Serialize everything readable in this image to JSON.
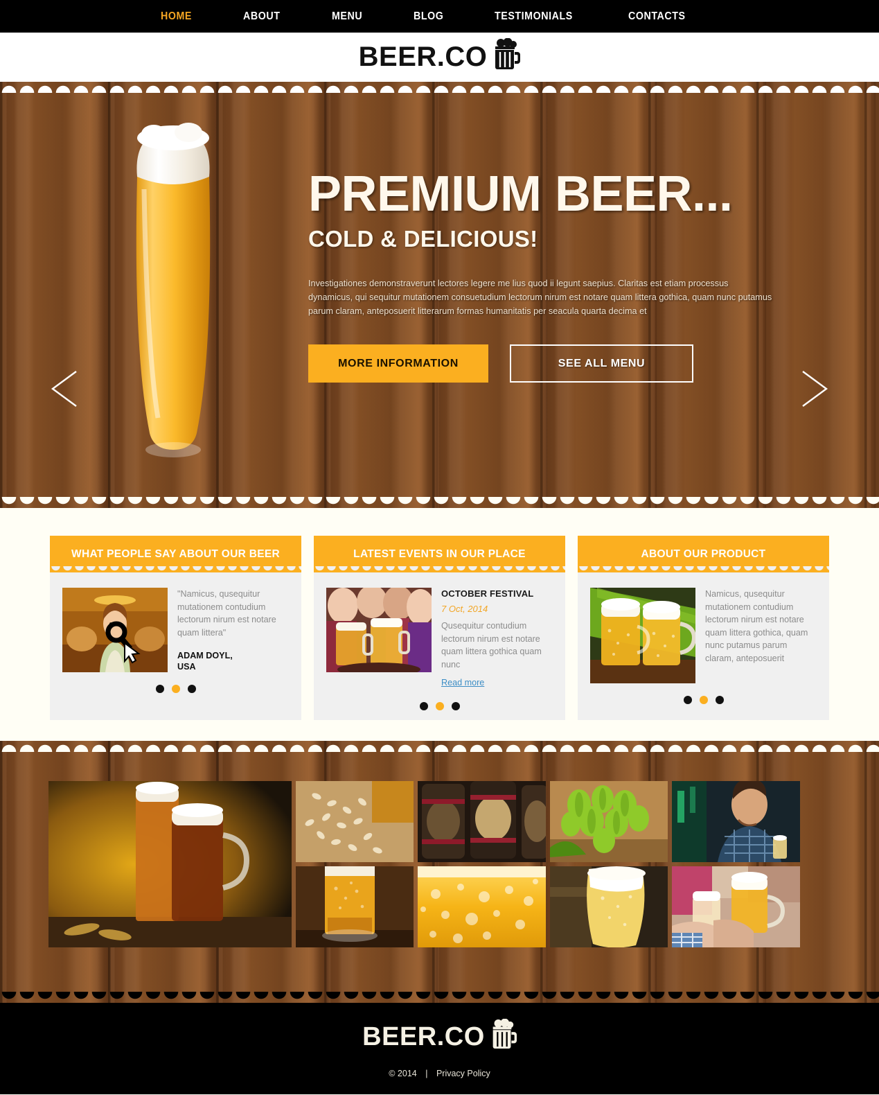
{
  "colors": {
    "accent": "#FBAF20",
    "nav_active": "#F5A623",
    "cream_bg": "#FFFEF5",
    "card_bg": "#F0F0F0",
    "link_blue": "#3C8DC5",
    "wood_dark": "#6E3F1D",
    "black": "#000000"
  },
  "nav": {
    "items": [
      {
        "label": "HOME",
        "active": true
      },
      {
        "label": "ABOUT",
        "active": false
      },
      {
        "label": "MENU",
        "active": false
      },
      {
        "label": "BLOG",
        "active": false
      },
      {
        "label": "TESTIMONIALS",
        "active": false
      },
      {
        "label": "CONTACTS",
        "active": false
      }
    ]
  },
  "logo": {
    "text": "BEER.CO",
    "icon": "beer-mug-icon"
  },
  "hero": {
    "title": "PREMIUM BEER...",
    "subtitle": "COLD & DELICIOUS!",
    "paragraph": "Investigationes demonstraverunt lectores legere me lius quod ii legunt saepius. Claritas est etiam processus dynamicus, qui sequitur mutationem consuetudium lectorum nirum est notare quam littera gothica, quam nunc putamus parum claram, anteposuerit litterarum formas humanitatis per seacula quarta decima et",
    "primary_button": "MORE INFORMATION",
    "secondary_button": "SEE ALL MENU",
    "prev_arrow": "chevron-left-icon",
    "next_arrow": "chevron-right-icon",
    "image_alt": "tall-beer-glass"
  },
  "cards": [
    {
      "id": "testimonials",
      "title": "WHAT PEOPLE SAY ABOUT  OUR BEER",
      "image_alt": "waitress-serving-beer",
      "quote": "\"Namicus, qusequitur mutationem contudium lectorum nirum est notare quam littera\"",
      "author": "ADAM DOYL,\nUSA",
      "author_line1": "ADAM DOYL,",
      "author_line2": "USA",
      "dots": [
        "off",
        "on",
        "off"
      ]
    },
    {
      "id": "events",
      "title": "LATEST EVENTS IN OUR PLACE",
      "image_alt": "people-toasting-beer-mugs",
      "event_title": "OCTOBER FESTIVAL",
      "event_date": "7 Oct, 2014",
      "body": "Qusequitur contudium lectorum nirum est notare quam littera gothica quam nunc",
      "read_more": "Read more",
      "dots": [
        "off",
        "on",
        "off"
      ]
    },
    {
      "id": "product",
      "title": "ABOUT OUR PRODUCT",
      "image_alt": "two-beer-mugs-on-leaf",
      "body": "Namicus, qusequitur mutationem contudium lectorum nirum est notare quam littera gothica, quam nunc putamus parum claram, anteposuerit",
      "dots": [
        "off",
        "on",
        "off"
      ]
    }
  ],
  "gallery": {
    "items": [
      {
        "alt": "beer-glass-and-mug-large"
      },
      {
        "alt": "barley-grains"
      },
      {
        "alt": "wooden-beer-barrels"
      },
      {
        "alt": "green-hops"
      },
      {
        "alt": "man-drinking-at-bar"
      },
      {
        "alt": "beer-glass-on-table"
      },
      {
        "alt": "beer-bubbles-closeup"
      },
      {
        "alt": "glass-of-lager"
      },
      {
        "alt": "hands-toasting-beer"
      }
    ]
  },
  "footer": {
    "logo": "BEER.CO",
    "copyright": "© 2014",
    "separator": "|",
    "privacy": "Privacy Policy"
  }
}
